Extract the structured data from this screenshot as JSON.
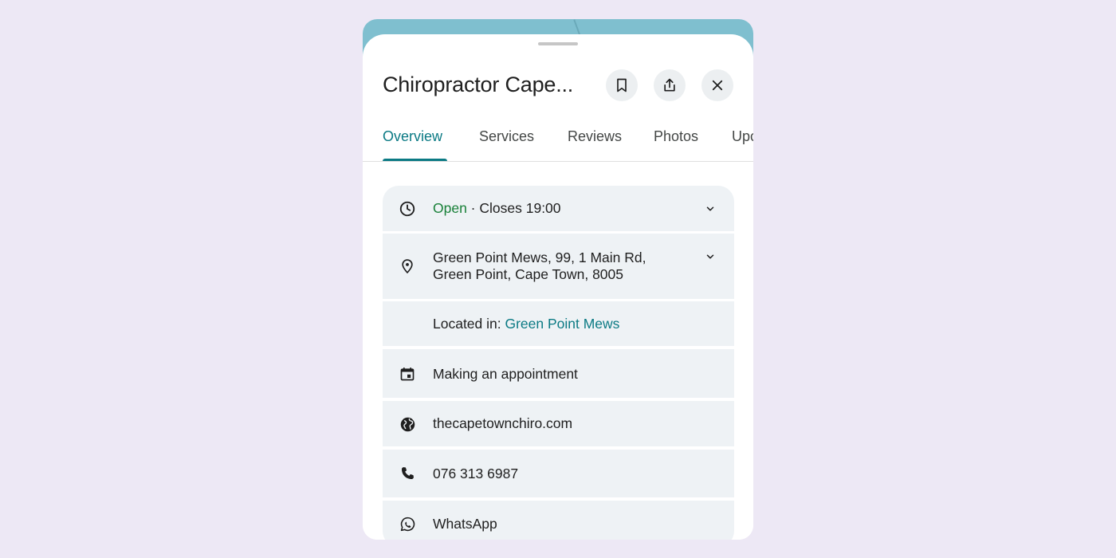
{
  "place": {
    "title": "Chiropractor Cape..."
  },
  "header_actions": {
    "save_icon": "bookmark-icon",
    "share_icon": "share-icon",
    "close_icon": "close-icon"
  },
  "tabs": [
    {
      "label": "Overview",
      "active": true
    },
    {
      "label": "Services",
      "active": false
    },
    {
      "label": "Reviews",
      "active": false
    },
    {
      "label": "Photos",
      "active": false
    },
    {
      "label": "Upc",
      "active": false
    }
  ],
  "info": {
    "hours": {
      "status": "Open",
      "separator": " · ",
      "closes": "Closes 19:00",
      "icon": "clock-icon"
    },
    "address": {
      "line1": "Green Point Mews, 99, 1 Main Rd,",
      "line2": "Green Point, Cape Town, 8005",
      "icon": "location-pin-icon"
    },
    "located_in": {
      "label": "Located in: ",
      "value": "Green Point Mews"
    },
    "appointment": {
      "label": "Making an appointment",
      "icon": "calendar-icon"
    },
    "website": {
      "label": "thecapetownchiro.com",
      "icon": "globe-icon"
    },
    "phone": {
      "label": "076 313 6987",
      "icon": "phone-icon"
    },
    "whatsapp": {
      "label": "WhatsApp",
      "icon": "whatsapp-icon"
    }
  },
  "colors": {
    "accent": "#0b7a84",
    "open_status": "#188038",
    "row_bg": "#eef2f5",
    "page_bg": "#ede8f5"
  }
}
